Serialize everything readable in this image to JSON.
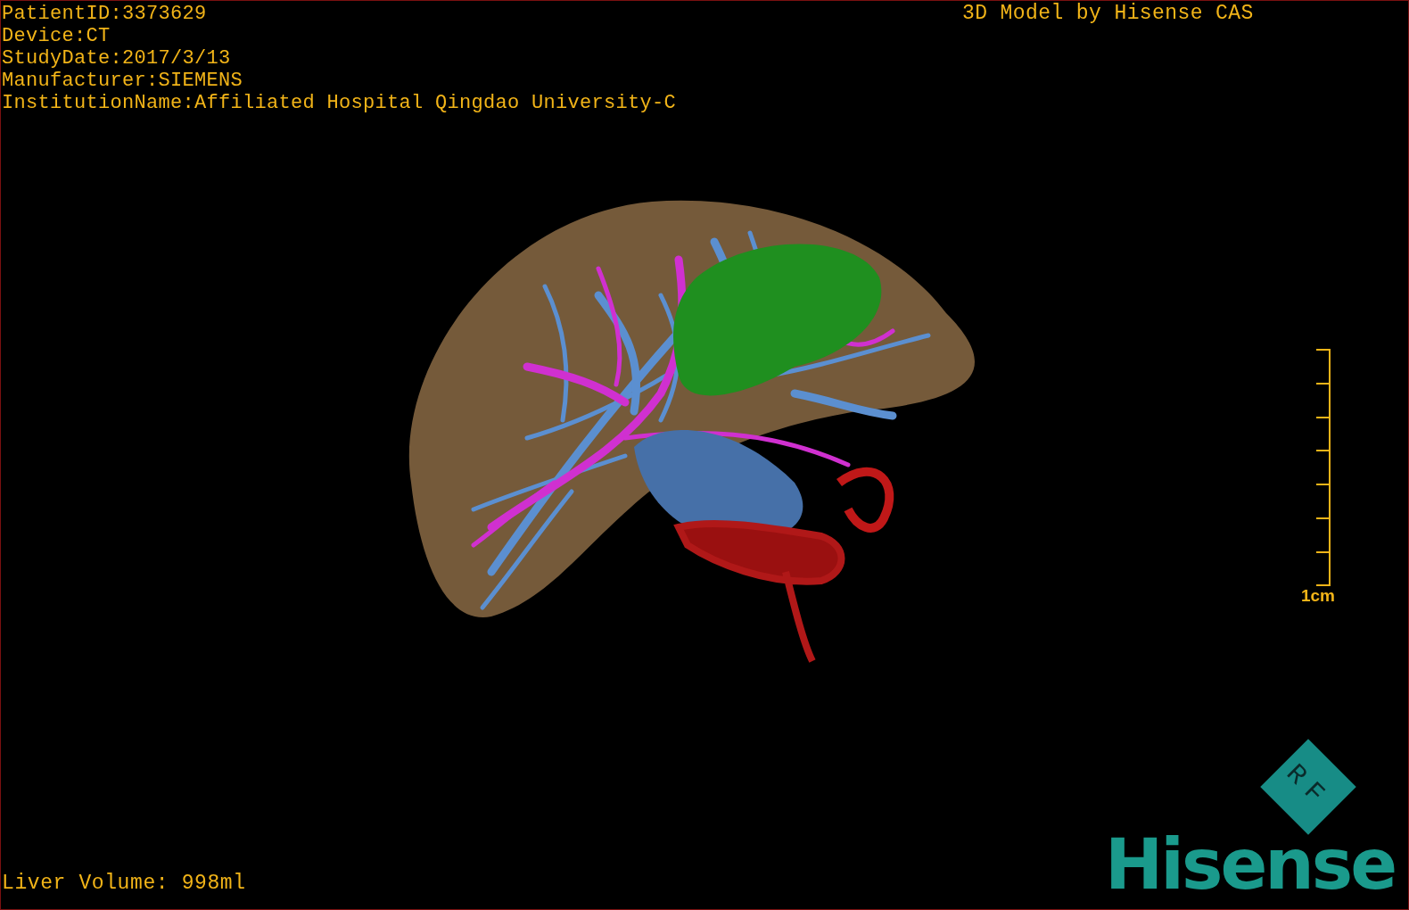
{
  "patient_info": [
    "PatientID:3373629",
    "Device:CT",
    "StudyDate:2017/3/13",
    "Manufacturer:SIEMENS",
    "InstitutionName:Affiliated Hospital Qingdao University-C"
  ],
  "model_title": "3D Model by Hisense CAS",
  "scale_bar": {
    "label": "1cm"
  },
  "liver_volume": "Liver Volume: 998ml",
  "logo": {
    "badge": "RF",
    "wordmark": "Hisense"
  }
}
